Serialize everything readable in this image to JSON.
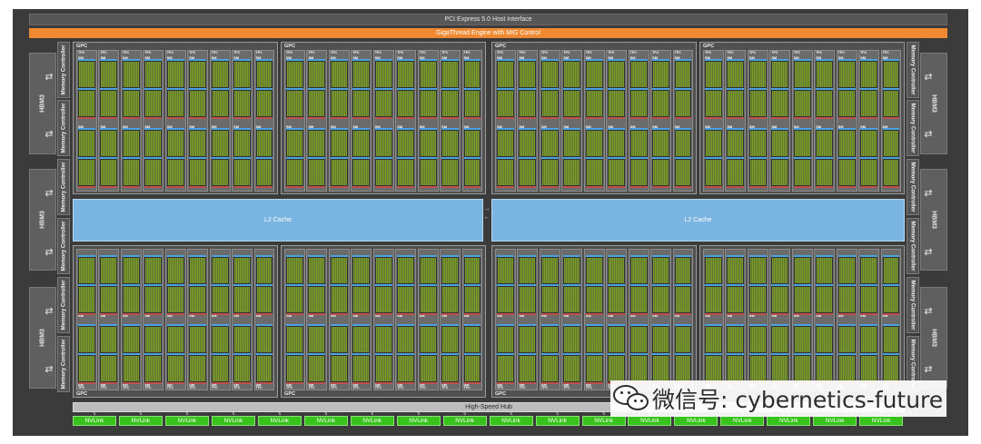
{
  "header": {
    "pcie_label": "PCI Express 5.0 Host Interface",
    "giga_label": "GigaThread Engine with MIG Control"
  },
  "memory": {
    "hbm_label": "HBM3",
    "controller_label": "Memory Controller",
    "hbm_count_per_side": 3,
    "controllers_per_side": 6
  },
  "gpc": {
    "label": "GPC",
    "tpc_label": "TPC",
    "sm_label": "SM",
    "count": 8,
    "tpcs_per_gpc": 9
  },
  "cache": {
    "left_label": "L2 Cache",
    "right_label": "L2 Cache"
  },
  "hub": {
    "label": "High-Speed Hub"
  },
  "nvlink": {
    "label": "NVLink",
    "count": 18
  },
  "watermark": {
    "text": "微信号: cybernetics-future"
  },
  "colors": {
    "die_background": "#3b3b3b",
    "gigathread": "#f08a32",
    "l2_cache": "#7ab4e0",
    "nvlink": "#37c21c",
    "sm_core": "#8fb82a"
  }
}
